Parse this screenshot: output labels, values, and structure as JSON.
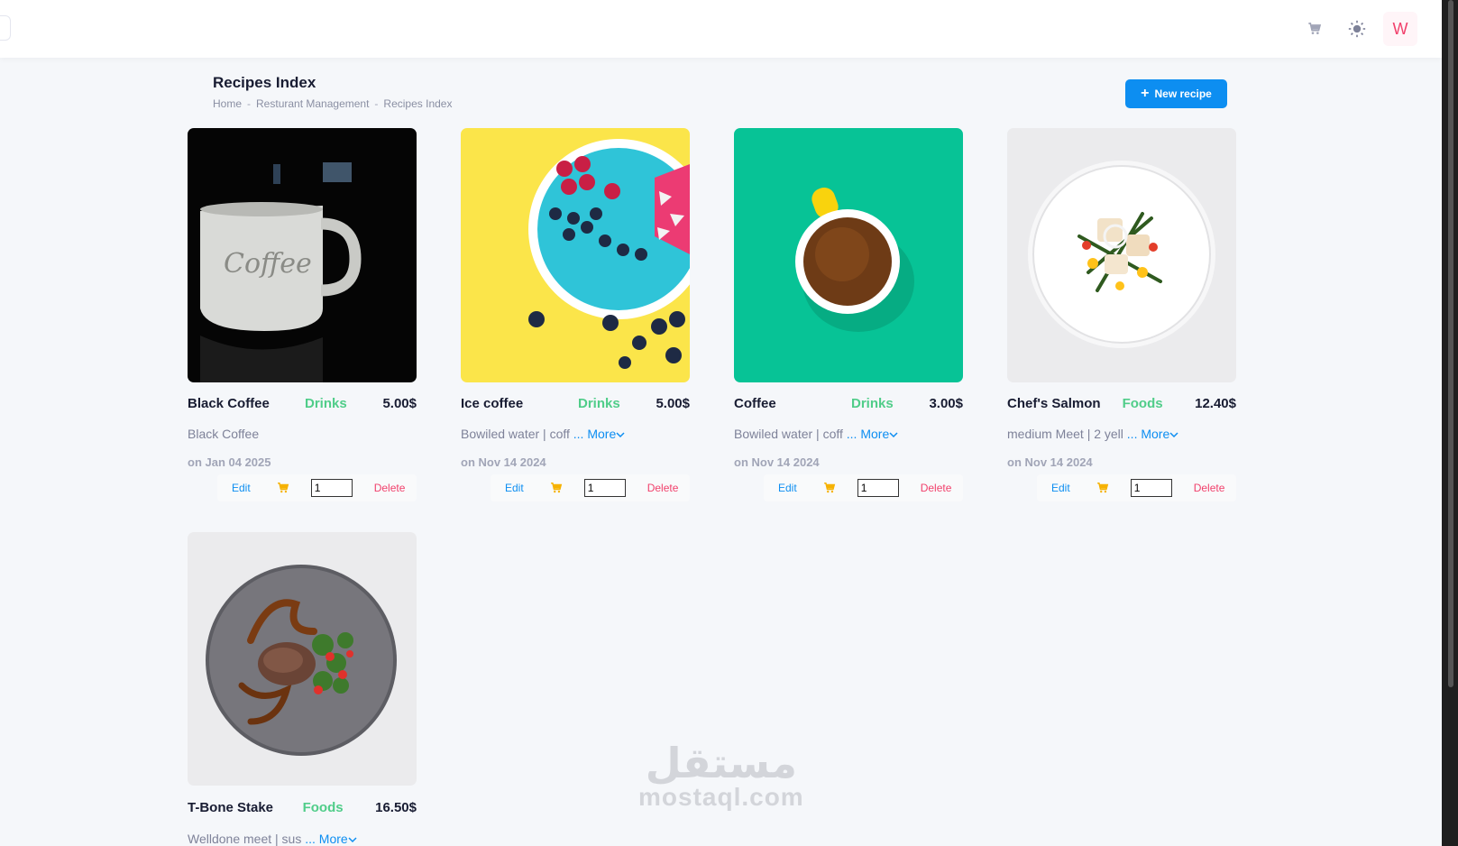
{
  "topbar": {
    "cart_icon": "cart-icon",
    "theme_icon": "sun-icon",
    "avatar_initial": "W"
  },
  "page": {
    "title": "Recipes Index",
    "breadcrumb": [
      "Home",
      "Resturant Management",
      "Recipes Index"
    ],
    "new_button_label": "New recipe"
  },
  "recipes": [
    {
      "name": "Black Coffee",
      "category": "Drinks",
      "price": "5.00$",
      "description": "Black Coffee",
      "more": "",
      "date": "on Jan 04 2025",
      "quantity": "1",
      "edit_label": "Edit",
      "delete_label": "Delete"
    },
    {
      "name": "Ice coffee",
      "category": "Drinks",
      "price": "5.00$",
      "description": "Bowiled water | coff",
      "more": "... More",
      "date": "on Nov 14 2024",
      "quantity": "1",
      "edit_label": "Edit",
      "delete_label": "Delete"
    },
    {
      "name": "Coffee",
      "category": "Drinks",
      "price": "3.00$",
      "description": "Bowiled water | coff",
      "more": "... More",
      "date": "on Nov 14 2024",
      "quantity": "1",
      "edit_label": "Edit",
      "delete_label": "Delete"
    },
    {
      "name": "Chef's Salmon",
      "category": "Foods",
      "price": "12.40$",
      "description": "medium Meet | 2 yell",
      "more": "... More",
      "date": "on Nov 14 2024",
      "quantity": "1",
      "edit_label": "Edit",
      "delete_label": "Delete"
    },
    {
      "name": "T-Bone Stake",
      "category": "Foods",
      "price": "16.50$",
      "description": "Welldone meet | sus",
      "more": "... More",
      "date": "",
      "quantity": "",
      "edit_label": "",
      "delete_label": ""
    }
  ],
  "watermark": {
    "arabic": "مستقل",
    "latin": "mostaql.com"
  },
  "colors": {
    "primary": "#0d8ef1",
    "success": "#50cd89",
    "danger": "#f1416c",
    "cart": "#f6b100"
  }
}
